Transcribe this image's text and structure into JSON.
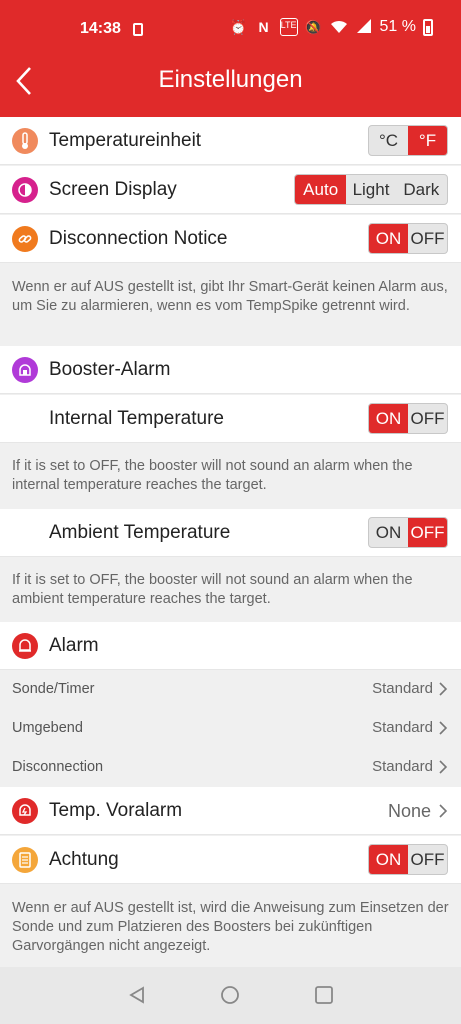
{
  "status_bar": {
    "time": "14:38",
    "battery": "51 %"
  },
  "header": {
    "title": "Einstellungen"
  },
  "temperature_unit": {
    "label": "Temperatureinheit",
    "options": [
      "°C",
      "°F"
    ],
    "selected": "°F"
  },
  "screen_display": {
    "label": "Screen Display",
    "options": [
      "Auto",
      "Light",
      "Dark"
    ],
    "selected": "Auto"
  },
  "disconnection_notice": {
    "label": "Disconnection Notice",
    "on": "ON",
    "off": "OFF",
    "state": "ON",
    "note": "Wenn er auf AUS gestellt ist, gibt Ihr Smart-Gerät keinen Alarm aus, um Sie zu alarmieren, wenn es vom TempSpike getrennt wird."
  },
  "booster_alarm": {
    "label": "Booster-Alarm"
  },
  "internal_temperature": {
    "label": "Internal Temperature",
    "on": "ON",
    "off": "OFF",
    "state": "ON",
    "note": "If it is set to OFF, the booster will not sound an alarm when the internal temperature reaches the target."
  },
  "ambient_temperature": {
    "label": "Ambient Temperature",
    "on": "ON",
    "off": "OFF",
    "state": "OFF",
    "note": "If it is set to OFF, the booster will not sound an alarm when the ambient temperature reaches the target."
  },
  "alarm": {
    "label": "Alarm",
    "items": [
      {
        "label": "Sonde/Timer",
        "value": "Standard"
      },
      {
        "label": "Umgebend",
        "value": "Standard"
      },
      {
        "label": "Disconnection",
        "value": "Standard"
      }
    ]
  },
  "pre_alarm": {
    "label": "Temp. Voralarm",
    "value": "None"
  },
  "attention": {
    "label": "Achtung",
    "on": "ON",
    "off": "OFF",
    "state": "ON",
    "note": "Wenn er auf AUS gestellt ist, wird die Anweisung zum Einsetzen der Sonde und zum Platzieren des Boosters bei zukünftigen Garvorgängen nicht angezeigt."
  },
  "colors": {
    "accent": "#e02a2a",
    "thermo_icon": "#f08a5d",
    "display_icon": "#d6218d",
    "link_icon": "#f07a1e",
    "booster_icon": "#b03ad8",
    "alarm_icon": "#e02a2a",
    "achtung_icon": "#f4a63a"
  }
}
